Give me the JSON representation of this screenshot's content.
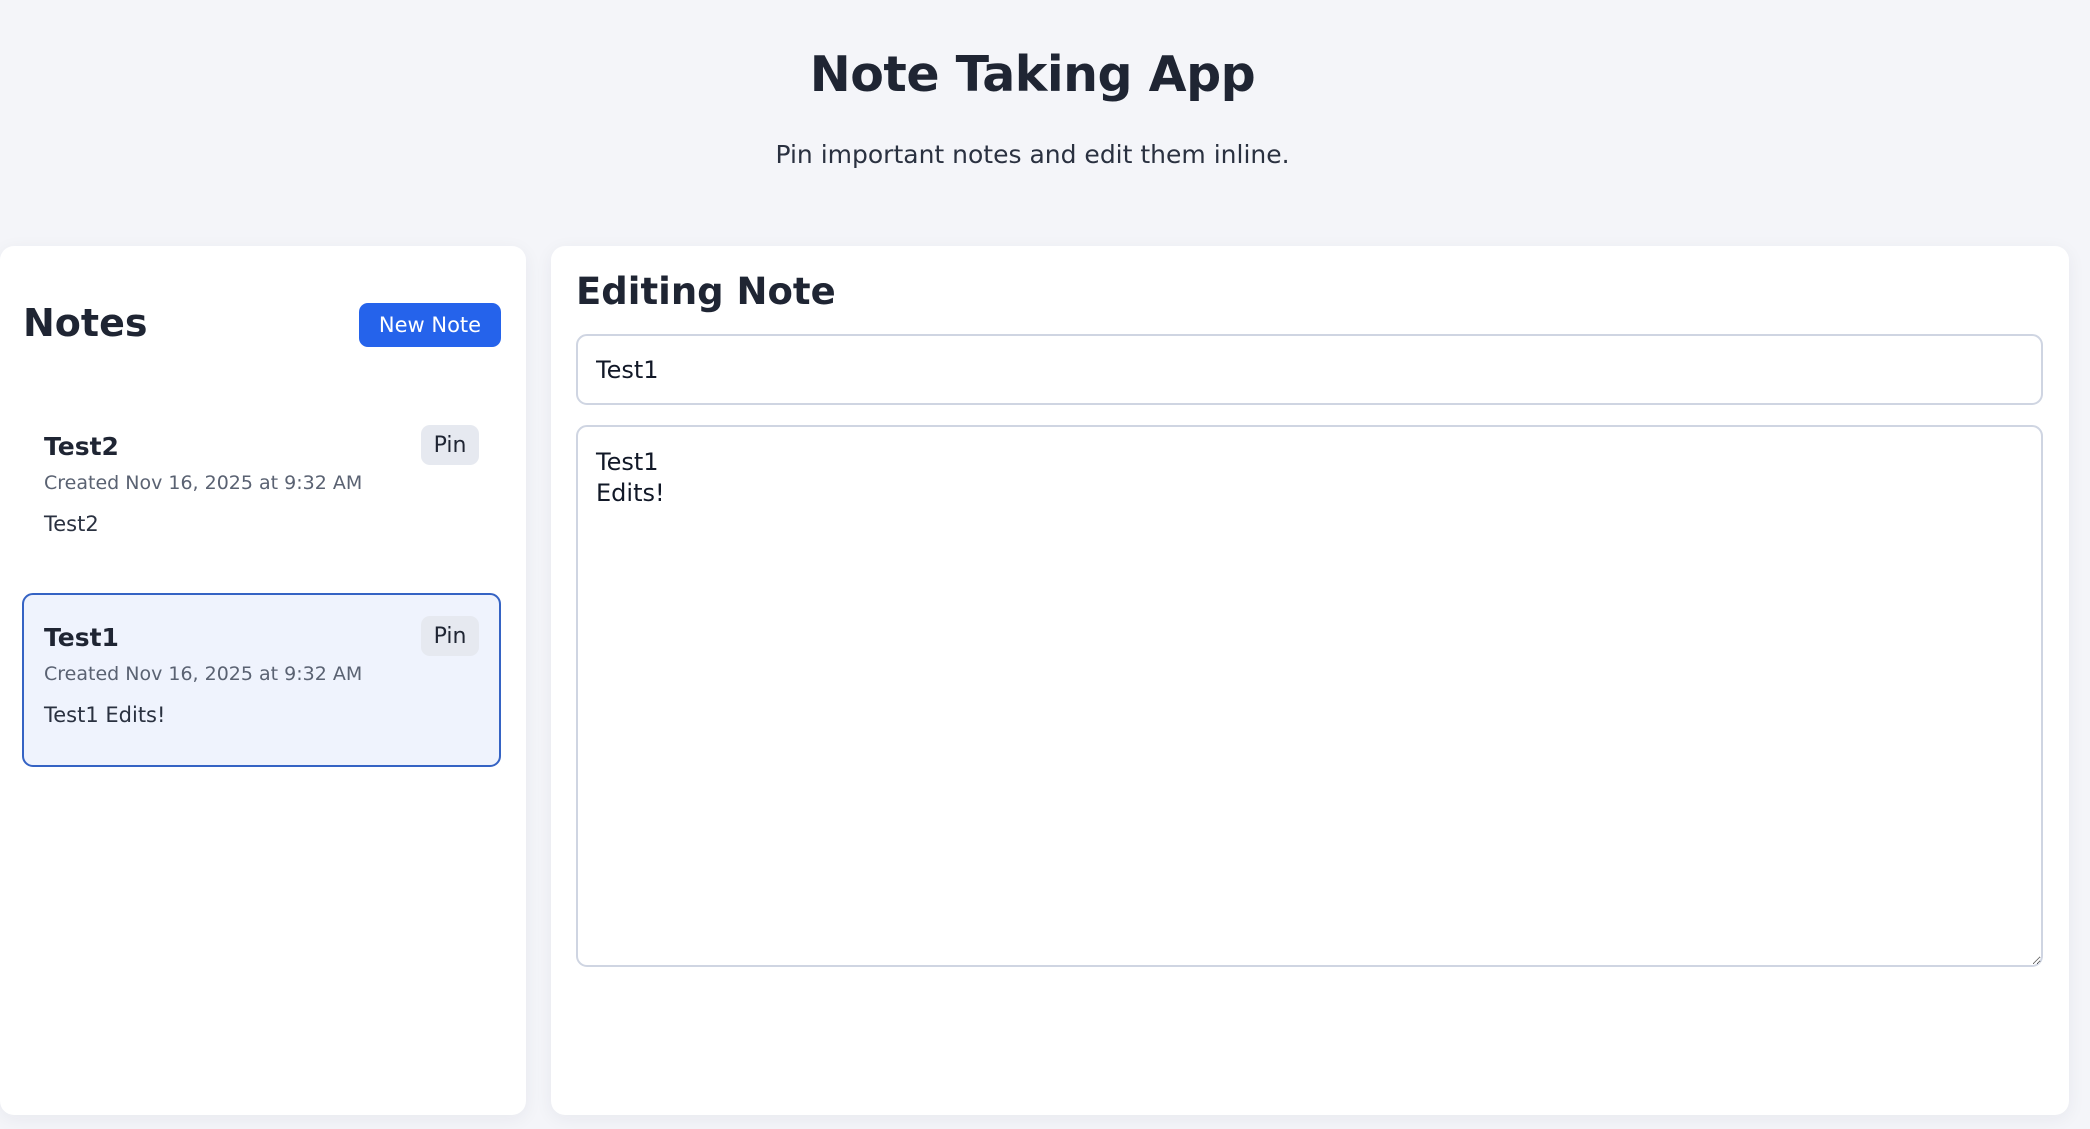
{
  "header": {
    "title": "Note Taking App",
    "subtitle": "Pin important notes and edit them inline."
  },
  "sidebar": {
    "title": "Notes",
    "new_note_label": "New Note",
    "notes": [
      {
        "title": "Test2",
        "pin_label": "Pin",
        "created": "Created Nov 16, 2025 at 9:32 AM",
        "preview": "Test2",
        "selected": false
      },
      {
        "title": "Test1",
        "pin_label": "Pin",
        "created": "Created Nov 16, 2025 at 9:32 AM",
        "preview": "Test1 Edits!",
        "selected": true
      }
    ]
  },
  "editor": {
    "heading": "Editing Note",
    "title_value": "Test1",
    "body_value": "Test1\nEdits!"
  },
  "colors": {
    "accent": "#2563eb",
    "selected_border": "#3563c4",
    "selected_background": "#eff3fd",
    "page_background": "#f4f5f9"
  }
}
